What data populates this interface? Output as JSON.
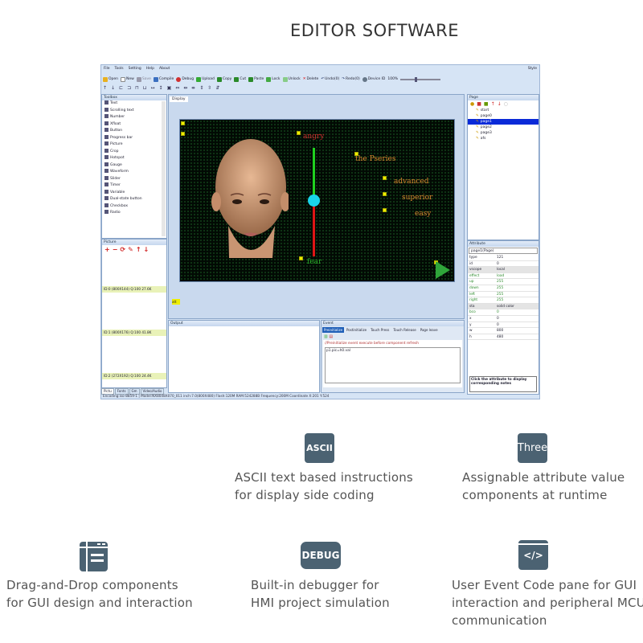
{
  "page_title": "EDITOR SOFTWARE",
  "app": {
    "menu": [
      "File",
      "Tools",
      "Setting",
      "Help",
      "About"
    ],
    "style_label": "Style",
    "toolbar": [
      "Open",
      "New",
      "Save",
      "Compile",
      "Debug",
      "Upload",
      "Copy",
      "Cut",
      "Paste",
      "Lock",
      "Unlock",
      "Delete",
      "Undo(0)",
      "Redo(0)",
      "Device ID",
      "100%"
    ],
    "toolbar2_icons": [
      "↑",
      "↓",
      "⊏",
      "⊐",
      "⊓",
      "⊔",
      "↔",
      "↕",
      "▣",
      "⇔",
      "⇹",
      "⇺",
      "⇕",
      "⇳",
      "⇵"
    ],
    "toolbox": {
      "title": "Toolbox",
      "items": [
        "Text",
        "Scrolling text",
        "Number",
        "Xfloat",
        "Button",
        "Progress bar",
        "Picture",
        "Crop",
        "Hotspot",
        "Gauge",
        "Waveform",
        "Slider",
        "Timer",
        "Variable",
        "Dual-state button",
        "Checkbox",
        "Radio"
      ]
    },
    "picture": {
      "title": "Picture",
      "icons": [
        "+",
        "−",
        "⟳",
        "✎",
        "↑",
        "↓"
      ],
      "items": [
        "ID:0 (800X144) Q:100 27.6K",
        "ID:1 (800X176) Q:100 41.8K",
        "ID:2 (272X192) Q:100 24.4K"
      ]
    },
    "bottom_tabs": [
      "Pictu",
      "Fonts",
      "Gm",
      "Video/Audio"
    ],
    "display": {
      "tab": "Display",
      "bottom_label": "att",
      "labels": {
        "top": "angry",
        "bottom": "fear",
        "series": "the Pseries",
        "l1": "advanced",
        "l2": "superior",
        "l3": "easy"
      },
      "slider_value": 0.48,
      "colors": {
        "upper": "#1fd21f",
        "lower": "#e01515",
        "knob": "#19d4ea"
      }
    },
    "output": {
      "title": "Output"
    },
    "event": {
      "title": "Event",
      "tabs": [
        "Preinitialize",
        "Postinitialize",
        "Touch Press",
        "Touch Release",
        "Page leave"
      ],
      "comment": "//Preinitialize event execute before component refresh",
      "code": "p1.pic=h0.val"
    },
    "page": {
      "title": "Page",
      "items": [
        "start",
        "page0",
        "page1",
        "page2",
        "page3",
        "afs"
      ],
      "selected": 2
    },
    "attribute": {
      "title": "Attribute",
      "selector": "page1(Page)",
      "rows": [
        [
          "type",
          "121"
        ],
        [
          "id",
          "0"
        ],
        [
          "vscope",
          "local"
        ],
        [
          "effect",
          "load"
        ],
        [
          "up",
          "255"
        ],
        [
          "down",
          "255"
        ],
        [
          "left",
          "255"
        ],
        [
          "right",
          "255"
        ],
        [
          "sta",
          "solid color"
        ],
        [
          "bco",
          "0"
        ],
        [
          "x",
          "0"
        ],
        [
          "y",
          "0"
        ],
        [
          "w",
          "800"
        ],
        [
          "h",
          "480"
        ]
      ],
      "note": "Click the attribute to display corresponding notes"
    },
    "status": "Encoding:iso-8859-1 | Model:NX8048X070_011 inch:7.0(800X480) Flash:120M RAM:524288B Frequency:200M    Coordinate X:201 Y:524"
  },
  "features": [
    {
      "icon": "ASCII",
      "lines": [
        "ASCII text based instructions",
        "for display side coding"
      ]
    },
    {
      "icon": "Three",
      "lines": [
        "Assignable attribute value",
        "components at runtime"
      ]
    },
    {
      "icon": "layout",
      "lines": [
        "Drag-and-Drop components",
        "for GUI design and interaction"
      ]
    },
    {
      "icon": "DEBUG",
      "lines": [
        "Built-in debugger for",
        "HMI project simulation"
      ]
    },
    {
      "icon": "</>",
      "lines": [
        "User Event Code pane for GUI",
        "interaction and peripheral MCU",
        "communication"
      ]
    }
  ]
}
